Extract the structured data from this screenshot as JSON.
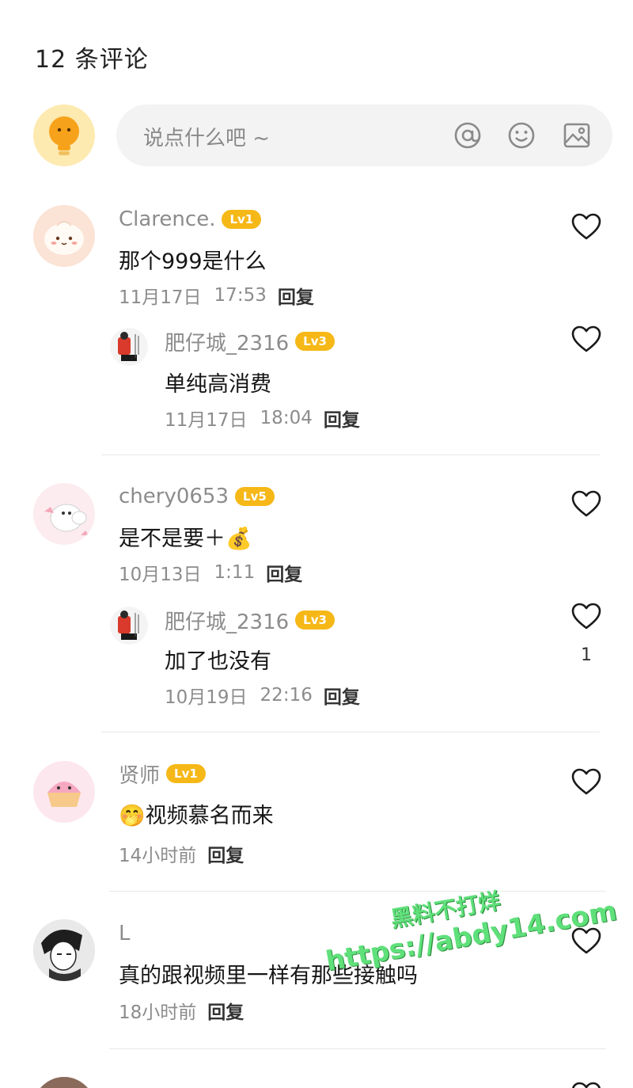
{
  "header": {
    "title": "12 条评论"
  },
  "composer": {
    "placeholder": "说点什么吧 ~",
    "icons": [
      "at-icon",
      "emoji-icon",
      "image-icon"
    ]
  },
  "comments": [
    {
      "username": "Clarence.",
      "level": "Lv1",
      "text": "那个999是什么",
      "date": "11月17日",
      "time": "17:53",
      "reply_label": "回复",
      "avatar": "steamed-bun-avatar",
      "replies": [
        {
          "username": "肥仔城_2316",
          "level": "Lv3",
          "text": "单纯高消费",
          "date": "11月17日",
          "time": "18:04",
          "reply_label": "回复",
          "avatar": "red-figure-avatar"
        }
      ]
    },
    {
      "username": "chery0653",
      "level": "Lv5",
      "text": "是不是要＋💰",
      "date": "10月13日",
      "time": "1:11",
      "reply_label": "回复",
      "avatar": "moomin-avatar",
      "replies": [
        {
          "username": "肥仔城_2316",
          "level": "Lv3",
          "text": "加了也没有",
          "date": "10月19日",
          "time": "22:16",
          "reply_label": "回复",
          "avatar": "red-figure-avatar",
          "likes": "1"
        }
      ]
    },
    {
      "username": "贤师",
      "level": "Lv1",
      "text": "🤭视频慕名而来",
      "date": "14小时前",
      "time": "",
      "reply_label": "回复",
      "avatar": "cupcake-avatar",
      "replies": []
    },
    {
      "username": "L",
      "level": "",
      "text": "真的跟视频里一样有那些接触吗",
      "date": "18小时前",
      "time": "",
      "reply_label": "回复",
      "avatar": "manga-avatar",
      "replies": []
    }
  ],
  "watermark": {
    "line1": "黑料不打烊",
    "line2": "https://abdy14.com"
  },
  "colors": {
    "level_badge": "#f6b817",
    "username": "#8c8c8c",
    "watermark": "#5fe07a"
  }
}
